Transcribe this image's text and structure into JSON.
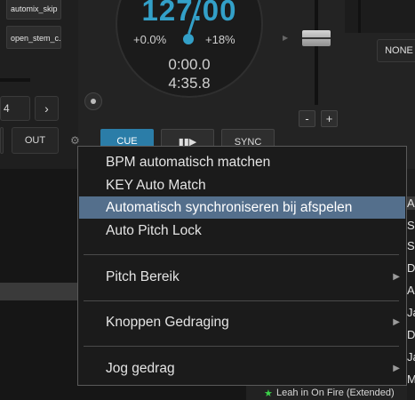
{
  "scripts": {
    "btn1": "automix_skip",
    "btn2": "open_stem_c..."
  },
  "deck": {
    "bpm": "127.00",
    "pitch_left": "+0.0%",
    "pitch_right": "+18%",
    "elapsed": "0:00.0",
    "remaining": "4:35.8",
    "loop_value": "4",
    "out_label": "OUT",
    "cue_label": "CUE",
    "sync_label": "SYNC",
    "fx_label": "NONE"
  },
  "pitch": {
    "minus": "-",
    "plus": "+"
  },
  "menu": {
    "items": [
      {
        "label": "BPM automatisch matchen"
      },
      {
        "label": "KEY Auto Match"
      },
      {
        "label": "Automatisch synchroniseren bij afspelen"
      },
      {
        "label": "Auto Pitch Lock"
      },
      {
        "label": "Pitch Bereik"
      },
      {
        "label": "Knoppen Gedraging"
      },
      {
        "label": "Jog gedrag"
      }
    ]
  },
  "browser": {
    "letters": [
      "A",
      "Sh",
      "S",
      "D",
      "A",
      "Ja",
      "D",
      "Ja",
      "M"
    ],
    "footer_text": "Leah in On Fire (Extended)"
  },
  "colors": {
    "accent": "#33a0c8",
    "menu_highlight": "#546f8c"
  }
}
